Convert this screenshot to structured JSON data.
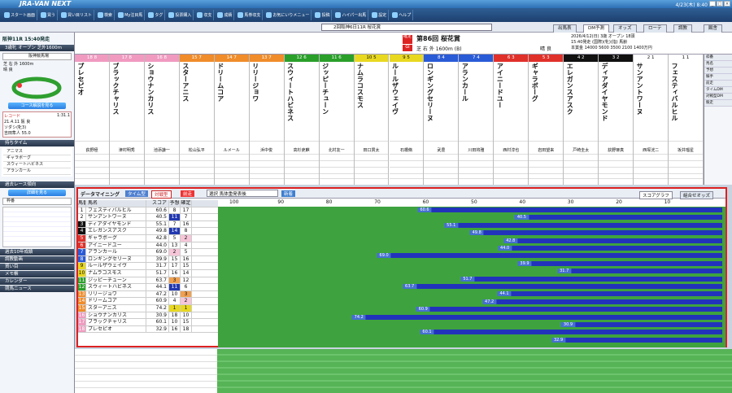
{
  "app": {
    "logo": "JRA-VAN NEXT",
    "datetime": "4/23(木) 8:40"
  },
  "toolbar": [
    "スタート画面",
    "買う",
    "買い目リスト",
    "検索",
    "My注目馬",
    "タグ",
    "投票購入",
    "収支",
    "成績",
    "馬券収支",
    "お気にいりメニュー",
    "投稿",
    "ハイパー出馬",
    "設定",
    "ヘルプ"
  ],
  "race": {
    "select": "2回阪神6日11R 桜花賞",
    "left_title": "阪神11R 15:40発走",
    "left_sub": "3歳牝 オープン 芝外1600m",
    "left_course": "阪神競馬場",
    "left_surface": "芝 右 外 1600m",
    "left_weather": "晴 良",
    "course_btn": "コース解説を見る",
    "record_label": "レコード",
    "record_time": "1:31.1",
    "record_date": "21.4.11 阪 良",
    "record_horse": "ソダシ(牝3)",
    "record_jockey": "吉田隼人 55.0",
    "number": "第86回",
    "name": "桜花賞",
    "grade": "GI",
    "course": "芝 右 外 1600m (B)",
    "weather": "晴",
    "ground": "良",
    "date": "2026/4/12(日) 3歳 オープン 18頭",
    "start": "15:40発走 (国際)(牝)(指) 馬齢",
    "prize": "本賞金 14000 5600 3500 2100 1400万円"
  },
  "left_sections": {
    "mochi": "持ちタイム",
    "kako": "過去レース傾向",
    "kako_btn": "詳細を見る",
    "kako_sel": "枠番",
    "ten": "過去10年成績",
    "chokyo": "調教動画",
    "kaime": "買い目",
    "memo": "メモ帳",
    "cal": "カレンダー",
    "news": "競馬ニュース"
  },
  "mochi_rows": [
    "アニマス",
    "ギャラボーグ",
    "スウィートハビネス",
    "アランカール"
  ],
  "tabs": [
    "出馬表",
    "DM予測",
    "オッズ",
    "ローテ",
    "調教",
    "厩舎"
  ],
  "horses": [
    {
      "no": 18,
      "waku": 8,
      "name": "プレセピオ",
      "jockey": "荻野極"
    },
    {
      "no": 17,
      "waku": 8,
      "name": "ブラックチャリス",
      "jockey": "津村明秀"
    },
    {
      "no": 16,
      "waku": 8,
      "name": "ショウナンカリス",
      "jockey": "池添謙一"
    },
    {
      "no": 15,
      "waku": 7,
      "name": "スターアニス",
      "jockey": "松山弘平"
    },
    {
      "no": 14,
      "waku": 7,
      "name": "ドリームコア",
      "jockey": "ルメール"
    },
    {
      "no": 13,
      "waku": 7,
      "name": "リリージョワ",
      "jockey": "浜中俊"
    },
    {
      "no": 12,
      "waku": 6,
      "name": "スウィートハビネス",
      "jockey": "高杉吏麒"
    },
    {
      "no": 11,
      "waku": 6,
      "name": "ジッピーチューン",
      "jockey": "北村友一"
    },
    {
      "no": 10,
      "waku": 5,
      "name": "ナムラコスモス",
      "jockey": "田口貫太"
    },
    {
      "no": 9,
      "waku": 5,
      "name": "ルールザウェイヴ",
      "jockey": "石橋脩"
    },
    {
      "no": 8,
      "waku": 4,
      "name": "ロンギングセリーヌ",
      "jockey": "武豊"
    },
    {
      "no": 7,
      "waku": 4,
      "name": "アランカール",
      "jockey": "川田将雅"
    },
    {
      "no": 6,
      "waku": 3,
      "name": "アイニードユー",
      "jockey": "西村淳也"
    },
    {
      "no": 5,
      "waku": 3,
      "name": "ギャラボーグ",
      "jockey": "岩田望来"
    },
    {
      "no": 4,
      "waku": 2,
      "name": "エレガンスアスク",
      "jockey": "戸崎圭太"
    },
    {
      "no": 3,
      "waku": 2,
      "name": "ディアダイヤモンド",
      "jockey": "荻野琢真"
    },
    {
      "no": 2,
      "waku": 1,
      "name": "サンアントワーヌ",
      "jockey": "西塚洸二"
    },
    {
      "no": 1,
      "waku": 1,
      "name": "フェスティバルヒル",
      "jockey": "坂井瑠星"
    }
  ],
  "right_labels": [
    "枠番",
    "馬名",
    "予想",
    "騎手",
    "前走",
    "タイムDM",
    "対戦型DM",
    "競走"
  ],
  "dm": {
    "title": "データマイニング",
    "tab1": "タイム型",
    "tab2": "対戦型",
    "tab3": "前走",
    "sort": "選択 馬体重発表後",
    "btn": "新着",
    "tab_graph": "スコアグラフ",
    "tab_odds": "組合せオッズ",
    "headers": [
      "馬番",
      "馬名",
      "スコア",
      "予想",
      "確定"
    ]
  },
  "score_rows": [
    {
      "no": 1,
      "name": "フェスティバルヒル",
      "score": 60.6,
      "yoso": "8",
      "kakutei": "17"
    },
    {
      "no": 2,
      "name": "サンアントワーヌ",
      "score": 40.5,
      "yoso": "11",
      "kakutei": "7"
    },
    {
      "no": 3,
      "name": "ディアダイヤモンド",
      "score": 55.1,
      "yoso": "7",
      "kakutei": "16"
    },
    {
      "no": 4,
      "name": "エレガンスアスク",
      "score": 49.8,
      "yoso": "14",
      "kakutei": "8"
    },
    {
      "no": 5,
      "name": "ギャラボーグ",
      "score": 42.8,
      "yoso": "5",
      "kakutei": "2"
    },
    {
      "no": 6,
      "name": "アイニードユー",
      "score": 44.0,
      "yoso": "13",
      "kakutei": "4"
    },
    {
      "no": 7,
      "name": "アランカール",
      "score": 69.0,
      "yoso": "2",
      "kakutei": "5"
    },
    {
      "no": 8,
      "name": "ロンギングセリーヌ",
      "score": 39.9,
      "yoso": "15",
      "kakutei": "16"
    },
    {
      "no": 9,
      "name": "ルールザウェイヴ",
      "score": 31.7,
      "yoso": "17",
      "kakutei": "15"
    },
    {
      "no": 10,
      "name": "ナムラコスモス",
      "score": 51.7,
      "yoso": "16",
      "kakutei": "14"
    },
    {
      "no": 11,
      "name": "ジッピーチューン",
      "score": 63.7,
      "yoso": "3",
      "kakutei": "12"
    },
    {
      "no": 12,
      "name": "スウィートハビネス",
      "score": 44.1,
      "yoso": "11",
      "kakutei": "6"
    },
    {
      "no": 13,
      "name": "リリージョワ",
      "score": 47.2,
      "yoso": "10",
      "kakutei": "3"
    },
    {
      "no": 14,
      "name": "ドリームコア",
      "score": 60.9,
      "yoso": "4",
      "kakutei": "2"
    },
    {
      "no": 15,
      "name": "スターアニス",
      "score": 74.2,
      "yoso": "1",
      "kakutei": "1"
    },
    {
      "no": 16,
      "name": "ショウナンカリス",
      "score": 30.9,
      "yoso": "18",
      "kakutei": "10"
    },
    {
      "no": 17,
      "name": "ブラックチャリス",
      "score": 60.1,
      "yoso": "10",
      "kakutei": "15"
    },
    {
      "no": 18,
      "name": "プレセピオ",
      "score": 32.9,
      "yoso": "16",
      "kakutei": "18"
    }
  ],
  "axis": [
    100,
    90,
    80,
    70,
    60,
    50,
    40,
    30,
    20,
    10
  ],
  "waku_colors": {
    "1": "#ffffff",
    "2": "#111111",
    "3": "#e0302a",
    "4": "#2a5bd7",
    "5": "#e8d820",
    "6": "#2aa02a",
    "7": "#f08c2a",
    "8": "#f09ac0"
  }
}
